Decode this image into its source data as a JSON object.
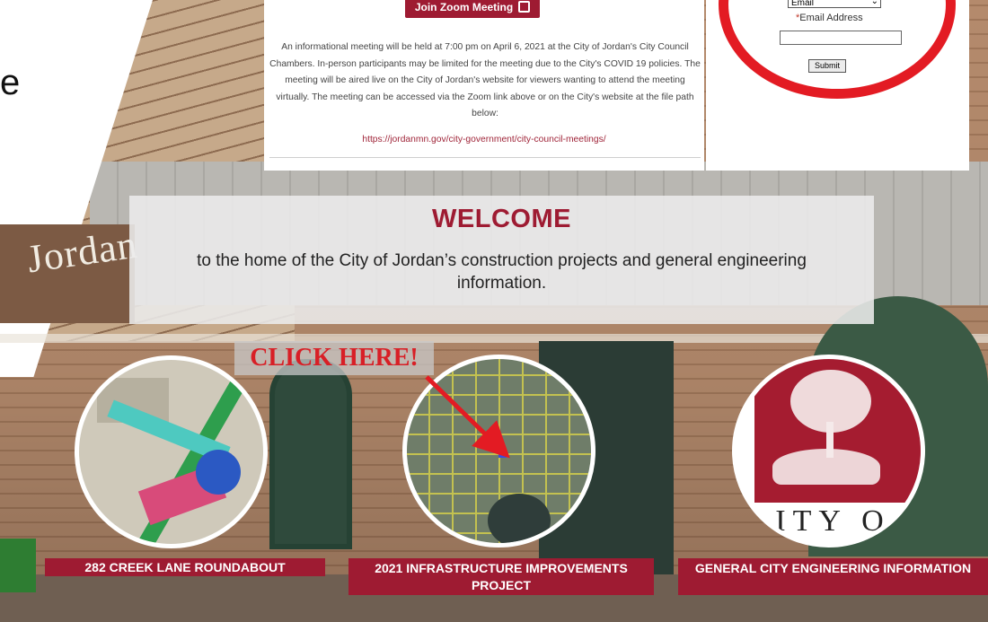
{
  "meeting": {
    "zoom_button": "Join Zoom Meeting",
    "paragraph": "An informational meeting will be held at 7:00 pm on April 6, 2021 at the City of Jordan's City Council Chambers. In-person participants may be limited for the meeting due to the City's COVID 19 policies. The meeting will be aired live on the City of Jordan's website for viewers wanting to attend the meeting virtually. The meeting can be accessed via the Zoom link above or on the City's website at the file path below:",
    "link": "https://jordanmn.gov/city-government/city-council-meetings/"
  },
  "form": {
    "select_value": "Email",
    "email_label": "Email Address",
    "required_mark": "*",
    "email_value": "",
    "submit_label": "Submit"
  },
  "welcome": {
    "title": "WELCOME",
    "subtitle": "to the home of the City of Jordan’s construction projects and general engineering information."
  },
  "background": {
    "building_sign": "Jordan",
    "partial_text": "e"
  },
  "callout": {
    "text": "CLICK HERE!"
  },
  "projects": [
    {
      "label": "282 CREEK LANE ROUNDABOUT"
    },
    {
      "label": "2021 INFRASTRUCTURE IMPROVEMENTS PROJECT"
    },
    {
      "label": "GENERAL CITY ENGINEERING INFORMATION",
      "emblem_text": "ITY O"
    }
  ],
  "colors": {
    "brand": "#9e1b32",
    "highlight_ring": "#e31b23",
    "callout_text": "#d81f26"
  }
}
